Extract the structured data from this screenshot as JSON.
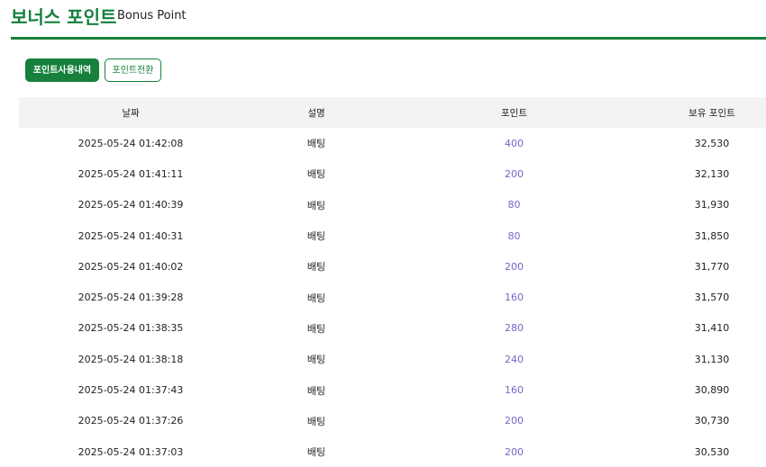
{
  "header": {
    "title_ko": "보너스 포인트",
    "title_en": "Bonus Point"
  },
  "tabs": {
    "history_label": "포인트사용내역",
    "convert_label": "포인트전환"
  },
  "colors": {
    "brand_green": "#16803c",
    "point_purple": "#7b62c9",
    "header_bg": "#f3f3f3"
  },
  "table": {
    "columns": [
      "날짜",
      "설명",
      "포인트",
      "보유 포인트"
    ],
    "rows": [
      {
        "date": "2025-05-24 01:42:08",
        "desc": "배팅",
        "point": "400",
        "balance": "32,530"
      },
      {
        "date": "2025-05-24 01:41:11",
        "desc": "배팅",
        "point": "200",
        "balance": "32,130"
      },
      {
        "date": "2025-05-24 01:40:39",
        "desc": "배팅",
        "point": "80",
        "balance": "31,930"
      },
      {
        "date": "2025-05-24 01:40:31",
        "desc": "배팅",
        "point": "80",
        "balance": "31,850"
      },
      {
        "date": "2025-05-24 01:40:02",
        "desc": "배팅",
        "point": "200",
        "balance": "31,770"
      },
      {
        "date": "2025-05-24 01:39:28",
        "desc": "배팅",
        "point": "160",
        "balance": "31,570"
      },
      {
        "date": "2025-05-24 01:38:35",
        "desc": "배팅",
        "point": "280",
        "balance": "31,410"
      },
      {
        "date": "2025-05-24 01:38:18",
        "desc": "배팅",
        "point": "240",
        "balance": "31,130"
      },
      {
        "date": "2025-05-24 01:37:43",
        "desc": "배팅",
        "point": "160",
        "balance": "30,890"
      },
      {
        "date": "2025-05-24 01:37:26",
        "desc": "배팅",
        "point": "200",
        "balance": "30,730"
      },
      {
        "date": "2025-05-24 01:37:03",
        "desc": "배팅",
        "point": "200",
        "balance": "30,530"
      }
    ]
  }
}
